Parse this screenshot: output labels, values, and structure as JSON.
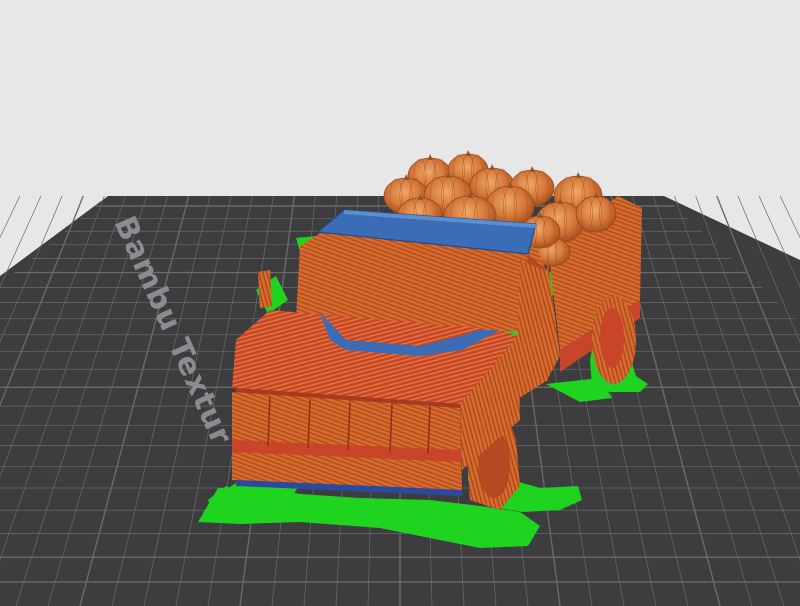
{
  "viewport": {
    "background_color": "#e7e7e8"
  },
  "build_plate": {
    "brand_text": "Bambu Textur",
    "color": "#3d3d3f",
    "grid_color": "#6a6a6d",
    "text_color": "#8c8c90"
  },
  "model": {
    "feature_colors": {
      "wall": "#d86b2e",
      "infill": "#c8452a",
      "top_surface": "#3a6db5",
      "support": "#1fd41f"
    }
  }
}
